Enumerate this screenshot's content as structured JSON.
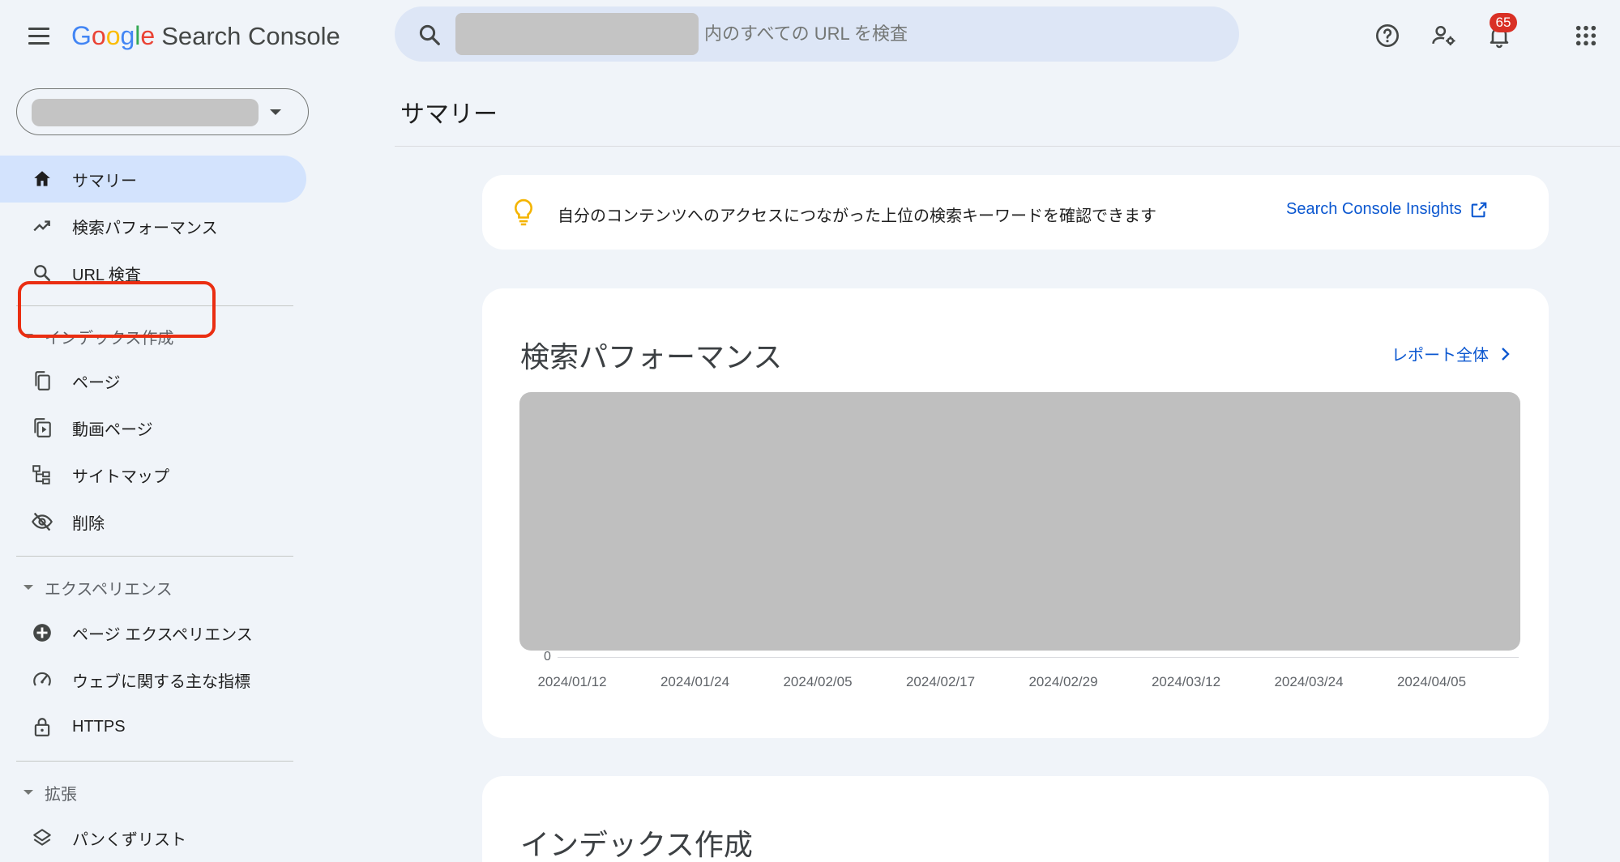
{
  "header": {
    "logo": {
      "g1": "G",
      "o1": "o",
      "o2": "o",
      "g2": "g",
      "l": "l",
      "e": "e",
      "product": "Search Console"
    },
    "search": {
      "placeholder": "内のすべての URL を検査"
    },
    "notifications_badge": "65",
    "icons": [
      "menu-icon",
      "search-icon",
      "help-icon",
      "manage-users-icon",
      "notifications-icon",
      "apps-icon"
    ]
  },
  "sidebar": {
    "top_items": [
      {
        "label": "サマリー",
        "icon": "home-icon",
        "active": true
      },
      {
        "label": "検索パフォーマンス",
        "icon": "trending-icon"
      },
      {
        "label": "URL 検査",
        "icon": "search-icon"
      }
    ],
    "sections": [
      {
        "title": "インデックス作成",
        "items": [
          {
            "label": "ページ",
            "icon": "pages-icon"
          },
          {
            "label": "動画ページ",
            "icon": "video-pages-icon"
          },
          {
            "label": "サイトマップ",
            "icon": "sitemap-icon"
          },
          {
            "label": "削除",
            "icon": "removals-icon"
          }
        ]
      },
      {
        "title": "エクスペリエンス",
        "items": [
          {
            "label": "ページ エクスペリエンス",
            "icon": "page-experience-icon"
          },
          {
            "label": "ウェブに関する主な指標",
            "icon": "speed-icon"
          },
          {
            "label": "HTTPS",
            "icon": "lock-icon"
          }
        ]
      },
      {
        "title": "拡張",
        "items": [
          {
            "label": "パンくずリスト",
            "icon": "layers-icon"
          }
        ]
      }
    ]
  },
  "main": {
    "page_title": "サマリー",
    "insights": {
      "text": "自分のコンテンツへのアクセスにつながった上位の検索キーワードを確認できます",
      "link": "Search Console Insights"
    },
    "performance": {
      "title": "検索パフォーマンス",
      "report_link": "レポート全体"
    },
    "index_card": {
      "title": "インデックス作成"
    }
  },
  "chart_data": {
    "type": "line",
    "x": [
      "2024/01/12",
      "2024/01/24",
      "2024/02/05",
      "2024/02/17",
      "2024/02/29",
      "2024/03/12",
      "2024/03/24",
      "2024/04/05"
    ],
    "y_tick_labels": [
      "0"
    ],
    "series": []
  },
  "colors": {
    "accent": "#0b57d0",
    "active_bg": "#d3e3fd",
    "page_bg": "#f0f4f9",
    "badge": "#d93025",
    "highlight": "#ea2e12"
  }
}
